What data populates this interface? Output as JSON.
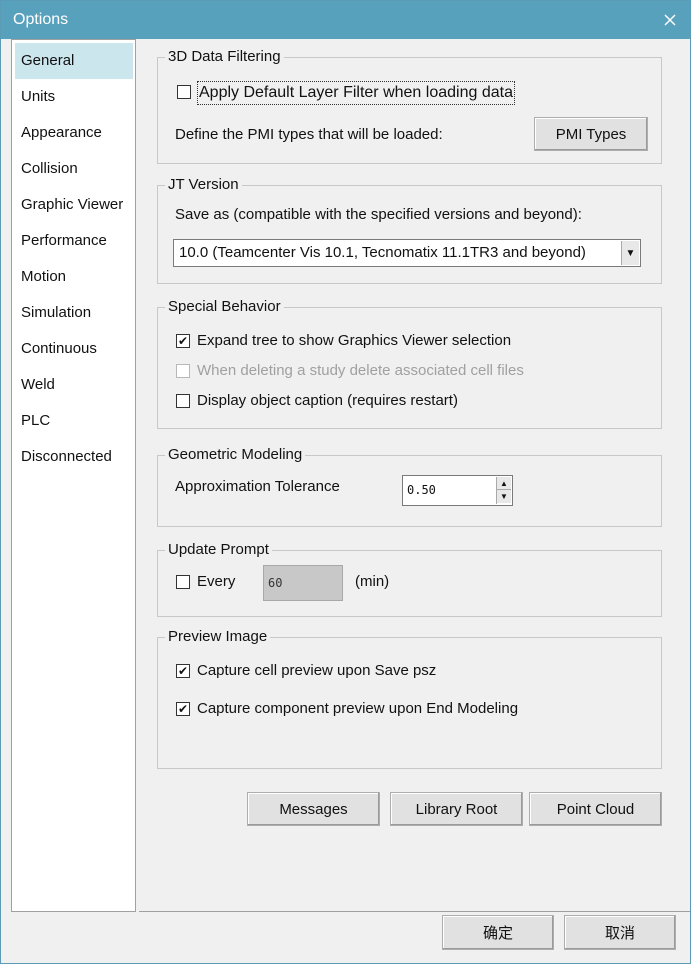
{
  "window": {
    "title": "Options"
  },
  "sidebar": {
    "items": [
      {
        "label": "General"
      },
      {
        "label": "Units"
      },
      {
        "label": "Appearance"
      },
      {
        "label": "Collision"
      },
      {
        "label": "Graphic Viewer"
      },
      {
        "label": "Performance"
      },
      {
        "label": "Motion"
      },
      {
        "label": "Simulation"
      },
      {
        "label": "Continuous"
      },
      {
        "label": "Weld"
      },
      {
        "label": "PLC"
      },
      {
        "label": "Disconnected"
      }
    ],
    "selected": "General"
  },
  "data_filtering": {
    "title": "3D Data Filtering",
    "apply_filter_label": "Apply Default Layer Filter when loading data",
    "apply_filter_checked": false,
    "pmi_label": "Define the PMI types that will be loaded:",
    "pmi_button": "PMI Types"
  },
  "jt_version": {
    "title": "JT Version",
    "save_as_label": "Save as (compatible with the specified versions and beyond):",
    "selected": "10.0 (Teamcenter Vis 10.1, Tecnomatix 11.1TR3 and beyond)"
  },
  "special_behavior": {
    "title": "Special Behavior",
    "options": [
      {
        "label": "Expand tree to show Graphics Viewer selection",
        "checked": true,
        "enabled": true
      },
      {
        "label": "When deleting a study delete associated cell files",
        "checked": false,
        "enabled": false
      },
      {
        "label": "Display object caption (requires restart)",
        "checked": false,
        "enabled": true
      }
    ]
  },
  "geometric_modeling": {
    "title": "Geometric Modeling",
    "tolerance_label": "Approximation Tolerance",
    "tolerance_value": "0.50"
  },
  "update_prompt": {
    "title": "Update Prompt",
    "every_label": "Every",
    "every_checked": false,
    "interval_value": "60",
    "unit_label": "(min)"
  },
  "preview_image": {
    "title": "Preview Image",
    "options": [
      {
        "label": "Capture cell preview upon Save psz",
        "checked": true
      },
      {
        "label": "Capture component preview upon End Modeling",
        "checked": true
      }
    ]
  },
  "actions": {
    "messages": "Messages",
    "library_root": "Library Root",
    "point_cloud": "Point Cloud"
  },
  "footer": {
    "ok": "确定",
    "cancel": "取消"
  },
  "icons": {
    "close": "close-icon",
    "checkmark": "checkmark-icon"
  },
  "colors": {
    "titlebar": "#58a1bd",
    "selected_item": "#cce6ee"
  }
}
